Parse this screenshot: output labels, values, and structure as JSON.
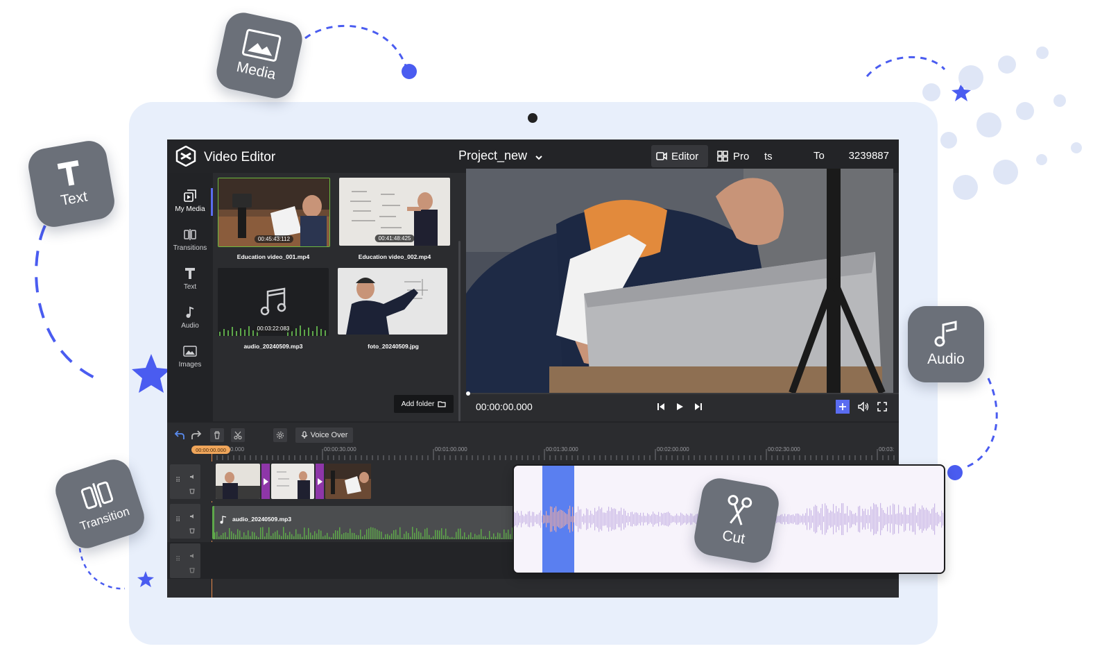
{
  "colors": {
    "accent": "#5a6cf0",
    "backdrop": "#e8effb",
    "badge": "#6b7079",
    "editor_bg": "#2b2c2f",
    "transition": "#8e36a8",
    "playhead": "#f0a65b"
  },
  "badges": {
    "media": {
      "label": "Media",
      "icon": "image-icon"
    },
    "text": {
      "label": "Text",
      "icon": "text-t-icon"
    },
    "transition": {
      "label": "Transition",
      "icon": "transition-icon"
    },
    "audio": {
      "label": "Audio",
      "icon": "music-note-icon"
    },
    "cut": {
      "label": "Cut",
      "icon": "scissors-icon"
    }
  },
  "app": {
    "title": "Video Editor",
    "project_name": "Project_new",
    "tabs": [
      {
        "label": "Editor",
        "icon": "camera-icon"
      },
      {
        "label": "Pro",
        "icon": "grid-icon"
      }
    ],
    "top_right_fragment_1": "Pro",
    "top_right_fragment_2": "ts",
    "top_right_fragment_3": "To",
    "top_right_number": "3239887"
  },
  "sidebar": {
    "items": [
      {
        "label": "My Media",
        "icon": "media-library-icon",
        "active": true
      },
      {
        "label": "Transitions",
        "icon": "transition-icon"
      },
      {
        "label": "Text",
        "icon": "text-t-icon"
      },
      {
        "label": "Audio",
        "icon": "music-note-icon"
      },
      {
        "label": "Images",
        "icon": "image-icon"
      }
    ]
  },
  "media": {
    "items": [
      {
        "name": "Education video_001.mp4",
        "duration": "00:45:43:112"
      },
      {
        "name": "Education video_002.mp4",
        "duration": "00:41:48:425"
      },
      {
        "name": "audio_20240509.mp3",
        "duration": "00:03:22:083"
      },
      {
        "name": "foto_20240509.jpg"
      }
    ],
    "add_folder_label": "Add folder"
  },
  "player": {
    "timecode": "00:00:00.000"
  },
  "toolbar": {
    "voice_over_label": "Voice Over"
  },
  "timeline": {
    "playhead_label": "00:00:00.000",
    "ruler_labels": [
      "00:00:30.000",
      "00:01:00.000",
      "00:01:30.000",
      "00:02:00.000",
      "00:02:30.000",
      "00:03:"
    ],
    "ruler_label_zero_fragment": "0.000",
    "audio_clip_name": "audio_20240509.mp3"
  }
}
